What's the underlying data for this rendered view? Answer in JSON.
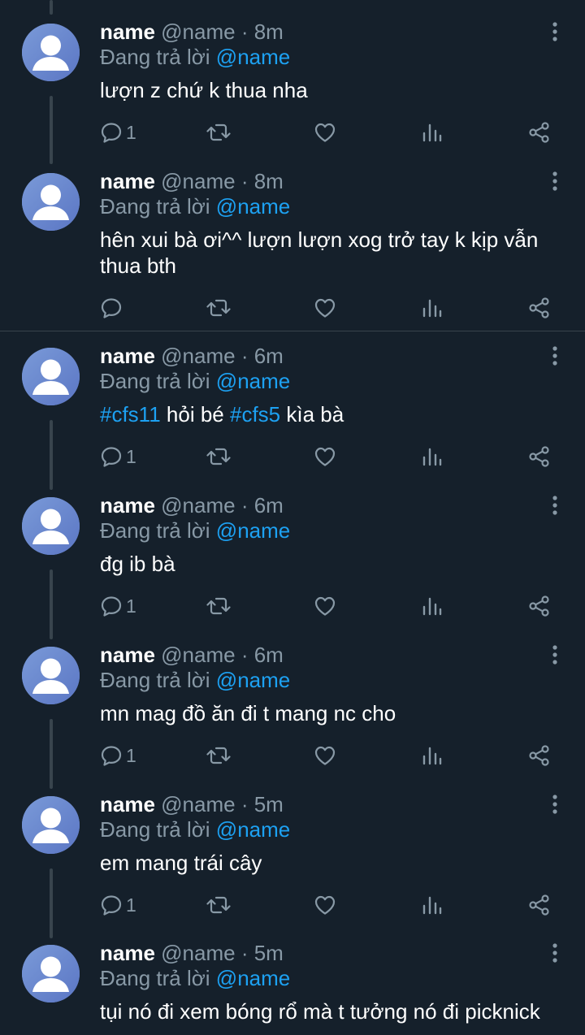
{
  "replying_prefix": "Đang trả lời",
  "colors": {
    "background": "#15202b",
    "secondary_text": "#8899a6",
    "accent": "#1da1f2",
    "line": "#38444d"
  },
  "icons": {
    "reply": "comment-bubble-icon",
    "retweet": "retweet-icon",
    "like": "heart-icon",
    "analytics": "analytics-bars-icon",
    "share": "share-icon",
    "more": "more-vertical-icon",
    "avatar": "default-profile-icon"
  },
  "tweets": [
    {
      "name": "name",
      "handle": "@name",
      "time": "8m",
      "mention": "@name",
      "text": [
        {
          "t": "lượn z chứ k thua nha"
        }
      ],
      "reply_count": "1"
    },
    {
      "name": "name",
      "handle": "@name",
      "time": "8m",
      "mention": "@name",
      "text": [
        {
          "t": "hên xui bà ơi^^ lượn lượn xog trở tay k kịp vẫn thua bth"
        }
      ],
      "reply_count": ""
    },
    {
      "name": "name",
      "handle": "@name",
      "time": "6m",
      "mention": "@name",
      "text": [
        {
          "t": "#cfs11",
          "tag": true
        },
        {
          "t": " hỏi bé "
        },
        {
          "t": "#cfs5",
          "tag": true
        },
        {
          "t": " kìa bà"
        }
      ],
      "reply_count": "1"
    },
    {
      "name": "name",
      "handle": "@name",
      "time": "6m",
      "mention": "@name",
      "text": [
        {
          "t": "đg ib bà"
        }
      ],
      "reply_count": "1"
    },
    {
      "name": "name",
      "handle": "@name",
      "time": "6m",
      "mention": "@name",
      "text": [
        {
          "t": "mn mag đồ ăn đi t mang nc cho"
        }
      ],
      "reply_count": "1"
    },
    {
      "name": "name",
      "handle": "@name",
      "time": "5m",
      "mention": "@name",
      "text": [
        {
          "t": "em mang trái cây"
        }
      ],
      "reply_count": "1"
    },
    {
      "name": "name",
      "handle": "@name",
      "time": "5m",
      "mention": "@name",
      "text": [
        {
          "t": "tụi nó đi xem bóng rổ mà t tưởng nó đi picknick"
        }
      ],
      "reply_count": ""
    }
  ]
}
